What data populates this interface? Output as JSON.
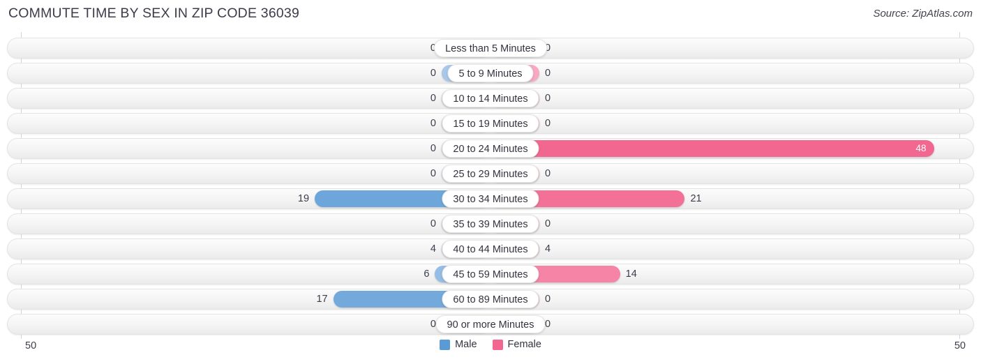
{
  "header": {
    "title": "COMMUTE TIME BY SEX IN ZIP CODE 36039",
    "source": "Source: ZipAtlas.com"
  },
  "axis": {
    "left_label": "50",
    "right_label": "50",
    "max": 50
  },
  "legend": {
    "items": [
      {
        "label": "Male",
        "color": "#5b9bd5"
      },
      {
        "label": "Female",
        "color": "#f2678f"
      }
    ]
  },
  "colors": {
    "male_low": "#a8c8ea",
    "male_high": "#5b9bd5",
    "female_low": "#f9a8c4",
    "female_high": "#f2678f",
    "track": "#f4f4f4",
    "text": "#3c3c4a"
  },
  "chart_data": {
    "type": "bar",
    "title": "COMMUTE TIME BY SEX IN ZIP CODE 36039",
    "xlabel": "",
    "ylabel": "",
    "orientation": "horizontal-diverging",
    "xlim": [
      -50,
      50
    ],
    "grid": true,
    "legend_position": "bottom-center",
    "categories": [
      "Less than 5 Minutes",
      "5 to 9 Minutes",
      "10 to 14 Minutes",
      "15 to 19 Minutes",
      "20 to 24 Minutes",
      "25 to 29 Minutes",
      "30 to 34 Minutes",
      "35 to 39 Minutes",
      "40 to 44 Minutes",
      "45 to 59 Minutes",
      "60 to 89 Minutes",
      "90 or more Minutes"
    ],
    "series": [
      {
        "name": "Male",
        "values": [
          0,
          0,
          0,
          0,
          0,
          0,
          19,
          0,
          4,
          6,
          17,
          0
        ]
      },
      {
        "name": "Female",
        "values": [
          0,
          0,
          0,
          0,
          48,
          0,
          21,
          0,
          4,
          14,
          0,
          0
        ]
      }
    ]
  }
}
